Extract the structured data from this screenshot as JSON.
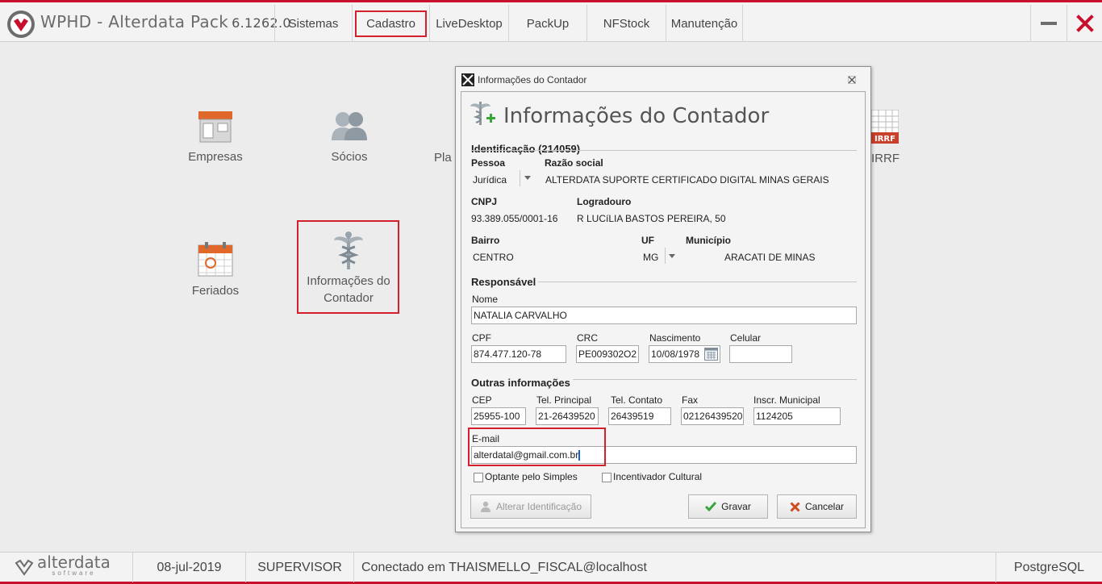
{
  "app": {
    "name": "WPHD - Alterdata Pack",
    "version": "6.1262.0"
  },
  "menu": [
    {
      "label": "Sistemas"
    },
    {
      "label": "Cadastro"
    },
    {
      "label": "LiveDesktop"
    },
    {
      "label": "PackUp"
    },
    {
      "label": "NFStock"
    },
    {
      "label": "Manutenção"
    }
  ],
  "tiles": {
    "empresas": "Empresas",
    "socios": "Sócios",
    "pla": "Pla",
    "irrf": "IRRF",
    "irrf_badge": "IRRF",
    "feriados": "Feriados",
    "contador_line1": "Informações do",
    "contador_line2": "Contador"
  },
  "dialog": {
    "window_title": "Informações do Contador",
    "heading": "Informações do Contador",
    "identificacao": {
      "title": "Identificação (214059)",
      "pessoa_label": "Pessoa",
      "pessoa_value": "Jurídica",
      "razao_label": "Razão social",
      "razao_value": "ALTERDATA SUPORTE CERTIFICADO DIGITAL MINAS GERAIS",
      "cnpj_label": "CNPJ",
      "cnpj_value": "93.389.055/0001-16",
      "logradouro_label": "Logradouro",
      "logradouro_value": "R LUCíLIA BASTOS PEREIRA, 50",
      "bairro_label": "Bairro",
      "bairro_value": "CENTRO",
      "uf_label": "UF",
      "uf_value": "MG",
      "municipio_label": "Município",
      "municipio_value": "ARACATI DE MINAS"
    },
    "responsavel": {
      "title": "Responsável",
      "nome_label": "Nome",
      "nome_value": "NATALIA CARVALHO",
      "cpf_label": "CPF",
      "cpf_value": "874.477.120-78",
      "crc_label": "CRC",
      "crc_value": "PE009302O2",
      "nascimento_label": "Nascimento",
      "nascimento_value": "10/08/1978",
      "celular_label": "Celular",
      "celular_value": ""
    },
    "outras": {
      "title": "Outras informações",
      "cep_label": "CEP",
      "cep_value": "25955-100",
      "tel_principal_label": "Tel. Principal",
      "tel_principal_value": "21-26439520",
      "tel_contato_label": "Tel. Contato",
      "tel_contato_value": "26439519",
      "fax_label": "Fax",
      "fax_value": "02126439520",
      "inscr_label": "Inscr. Municipal",
      "inscr_value": "1124205",
      "email_label": "E-mail",
      "email_value": "alterdatal@gmail.com.br",
      "optante_label": "Optante pelo Simples",
      "incentivador_label": "Incentivador Cultural"
    },
    "buttons": {
      "alterar": "Alterar Identificação",
      "gravar": "Gravar",
      "cancelar": "Cancelar"
    }
  },
  "status": {
    "brand": "alterdata",
    "brand_sub": "software",
    "date": "08-jul-2019",
    "user": "SUPERVISOR",
    "connection": "Conectado em THAISMELLO_FISCAL@localhost",
    "db": "PostgreSQL"
  },
  "colors": {
    "accent": "#c8102e",
    "highlight": "#d3202c"
  }
}
